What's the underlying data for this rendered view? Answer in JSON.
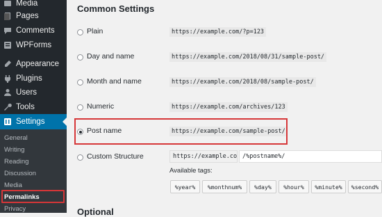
{
  "sidebar": {
    "items": [
      {
        "label": "Media",
        "icon": "media-icon"
      },
      {
        "label": "Pages",
        "icon": "pages-icon"
      },
      {
        "label": "Comments",
        "icon": "comments-icon"
      },
      {
        "label": "WPForms",
        "icon": "wpforms-icon"
      },
      {
        "label": "Appearance",
        "icon": "appearance-icon"
      },
      {
        "label": "Plugins",
        "icon": "plugins-icon"
      },
      {
        "label": "Users",
        "icon": "users-icon"
      },
      {
        "label": "Tools",
        "icon": "tools-icon"
      },
      {
        "label": "Settings",
        "icon": "settings-icon"
      }
    ],
    "submenu": [
      "General",
      "Writing",
      "Reading",
      "Discussion",
      "Media",
      "Permalinks",
      "Privacy"
    ]
  },
  "main": {
    "heading": "Common Settings",
    "options": [
      {
        "label": "Plain",
        "code": "https://example.com/?p=123",
        "checked": false
      },
      {
        "label": "Day and name",
        "code": "https://example.com/2018/08/31/sample-post/",
        "checked": false
      },
      {
        "label": "Month and name",
        "code": "https://example.com/2018/08/sample-post/",
        "checked": false
      },
      {
        "label": "Numeric",
        "code": "https://example.com/archives/123",
        "checked": false
      },
      {
        "label": "Post name",
        "code": "https://example.com/sample-post/",
        "checked": true
      },
      {
        "label": "Custom Structure",
        "checked": false
      }
    ],
    "custom_prefix": "https://example.com",
    "custom_value": "/%postname%/",
    "available_tags_label": "Available tags:",
    "tags": [
      "%year%",
      "%monthnum%",
      "%day%",
      "%hour%",
      "%minute%",
      "%second%"
    ],
    "heading2": "Optional"
  },
  "colors": {
    "accent": "#0073aa",
    "highlight": "#d63638",
    "sidebar": "#23282d"
  }
}
